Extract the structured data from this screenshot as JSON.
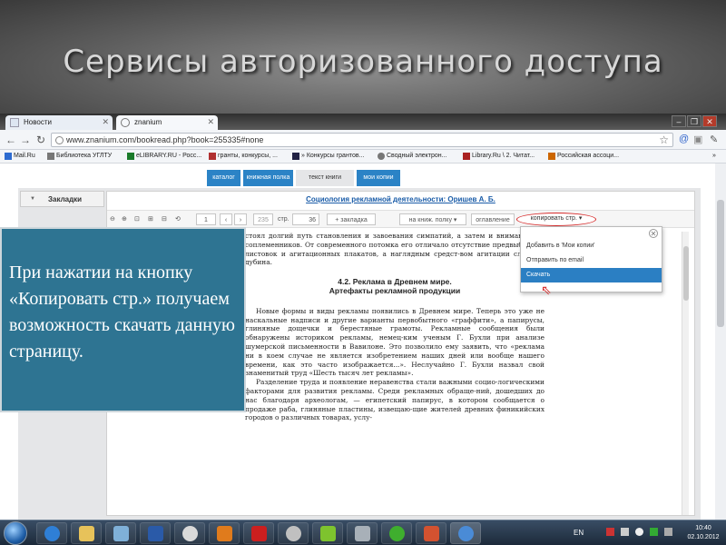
{
  "slide": {
    "title": "Сервисы авторизованного доступа"
  },
  "browser": {
    "tabs": [
      {
        "label": "Новости",
        "icon": "page-icon"
      },
      {
        "label": "znanium",
        "icon": "znanium-icon"
      }
    ],
    "url": "www.znanium.com/bookread.php?book=255335#none",
    "bookmarks": [
      {
        "label": "Mail.Ru",
        "icon": "mailru-icon",
        "color": "#2d6bd0"
      },
      {
        "label": "Библиотека УГЛТУ",
        "icon": "library-icon",
        "color": "#777777"
      },
      {
        "label": "eLIBRARY.RU - Росс...",
        "icon": "elibrary-icon",
        "color": "#1a7a2a"
      },
      {
        "label": "гранты, конкурсы, ...",
        "icon": "grant-icon",
        "color": "#b03030"
      },
      {
        "label": "» Конкурсы грантов...",
        "icon": "y-icon",
        "color": "#222244"
      },
      {
        "label": "Сводный электрон...",
        "icon": "catalog-icon",
        "color": "#777777"
      },
      {
        "label": "Library.Ru \\ 2. Читат...",
        "icon": "libraryru-icon",
        "color": "#aa2222"
      },
      {
        "label": "Российская ассоци...",
        "icon": "assoc-icon",
        "color": "#cc6600"
      }
    ]
  },
  "site": {
    "tabs": [
      {
        "label": "каталог",
        "active": false
      },
      {
        "label": "книжная полка",
        "active": false
      },
      {
        "label": "текст книги",
        "active": true
      },
      {
        "label": "мои копии",
        "active": false
      }
    ],
    "bookmarks_panel": "Закладки"
  },
  "reader": {
    "book_title": "Социология рекламной деятельности: Оришев А. Б.",
    "page_input": "1",
    "total_pages": "235",
    "page_label": "стр.",
    "current_page": "36",
    "add_bookmark": "+ закладка",
    "to_shelf": "на книж. полку ▾",
    "contents": "оглавление",
    "copy_page": "копировать стр. ▾"
  },
  "dropdown": {
    "items": [
      {
        "label": "Добавить в 'Мои копии'",
        "selected": false
      },
      {
        "label": "Отправить по email",
        "selected": false
      },
      {
        "label": "Скачать",
        "selected": true
      }
    ]
  },
  "document": {
    "para1": "стоял долгий путь становления и завоевания симпатий, а затем и вниманиярия соплеменников. От современного потомка его отличало отсутствие предвыборных листовок и агитационных плакатов, а наглядным средст-вом агитации служила дубина.",
    "heading1": "4.2. Реклама в Древнем мире.",
    "heading2": "Артефакты рекламной продукции",
    "para2": "Новые формы и виды рекламы появились в Древнем мире. Теперь это уже не наскальные надписи и другие варианты первобытного «граффити», а папирусы, глиняные дощечки и берестяные грамоты. Рекламные сообщения были обнаружены историком рекламы, немец-ким ученым Г. Бухли при анализе шумерской письменности в Вавилоне. Это позволило ему заявить, что «реклама ни в коем случае не является изобретением наших дней или вообще нашего времени, как это часто изображается...». Неслучайно Г. Бухли назвал свой знаменитый труд «Шесть тысяч лет рекламы».",
    "para3": "Разделение труда и появление неравенства стали важными социо-логическими факторами для развития рекламы. Среди рекламных обраще-ний, дошедших до нас благодаря археологам, — египетский папирус, в котором сообщается о продаже раба, глиняные пластины, извещаю-щие жителей древних финикийских городов о различных товарах, услу-"
  },
  "callout": {
    "text": "При нажатии на кнопку «Копировать стр.» получаем возможность скачать данную страницу."
  },
  "taskbar": {
    "language": "EN",
    "time": "10:40",
    "date": "02.10.2012",
    "apps": [
      {
        "icon": "ie-icon",
        "color": "#2f7fd6"
      },
      {
        "icon": "explorer-icon",
        "color": "#e7c25a"
      },
      {
        "icon": "notepad-icon",
        "color": "#7fb0d8"
      },
      {
        "icon": "word-icon",
        "color": "#2a5aa8"
      },
      {
        "icon": "clock-app-icon",
        "color": "#d9d9d9"
      },
      {
        "icon": "outlook-icon",
        "color": "#e07b1c"
      },
      {
        "icon": "acrobat-icon",
        "color": "#cc1f1f"
      },
      {
        "icon": "talk-icon",
        "color": "#c0c0c0"
      },
      {
        "icon": "chat-icon",
        "color": "#7ec32e"
      },
      {
        "icon": "game-icon",
        "color": "#a8b0b8"
      },
      {
        "icon": "mail-agent-icon",
        "color": "#3fae2e"
      },
      {
        "icon": "powerpoint-icon",
        "color": "#d35230"
      },
      {
        "icon": "chrome-icon",
        "color": "#4a8bd6"
      }
    ]
  }
}
